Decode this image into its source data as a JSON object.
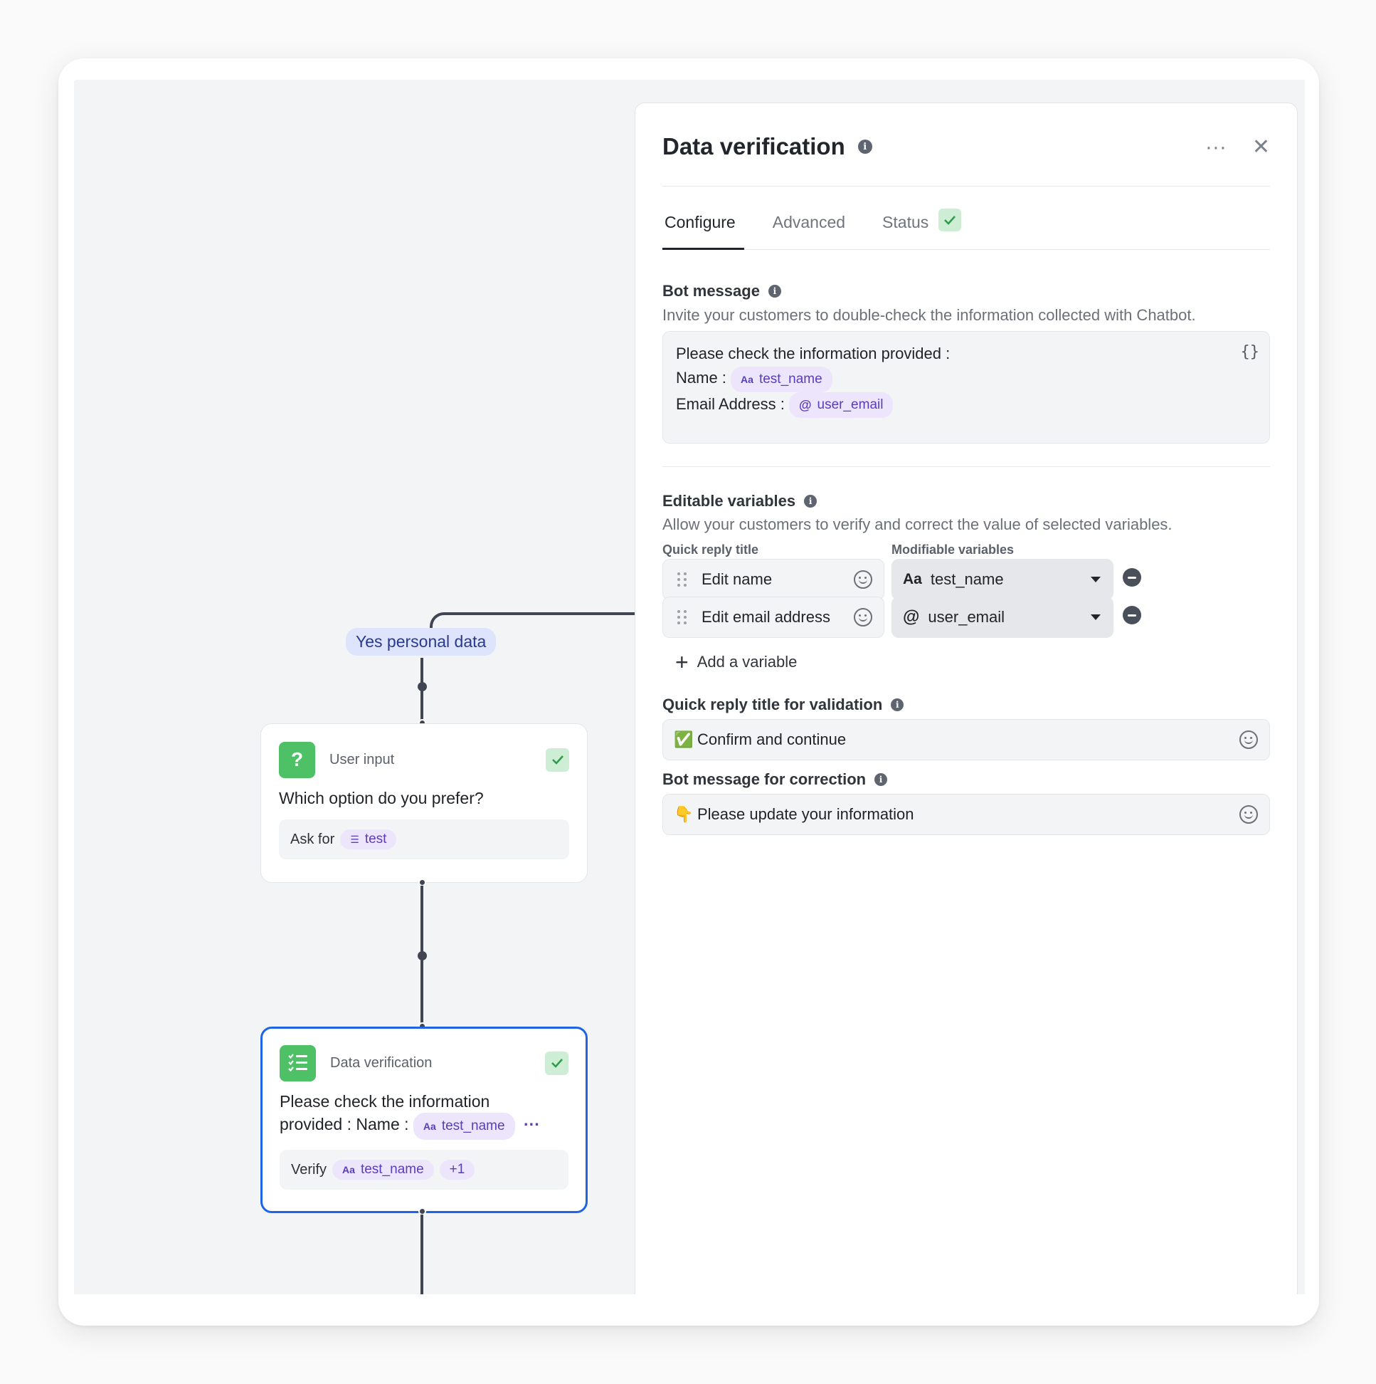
{
  "canvas": {
    "branch_tag": "Yes personal data",
    "user_input_node": {
      "type": "User input",
      "icon": "question-icon",
      "icon_glyph": "?",
      "question": "Which option do you prefer?",
      "footer_label": "Ask for",
      "variable": "test"
    },
    "data_verification_node": {
      "type": "Data verification",
      "icon": "checklist-icon",
      "text_line1": "Please check the information",
      "text_line2": "provided : Name :",
      "variable": "test_name",
      "ellipsis": "···",
      "footer_label": "Verify",
      "footer_variable": "test_name",
      "extra_count": "+1"
    }
  },
  "panel": {
    "title": "Data verification",
    "more_icon": "···",
    "close_icon": "✕",
    "tabs": [
      {
        "label": "Configure",
        "active": true
      },
      {
        "label": "Advanced",
        "active": false
      },
      {
        "label": "Status",
        "active": false
      }
    ],
    "bot_message": {
      "label": "Bot message",
      "description": "Invite your customers to double-check the information collected with Chatbot.",
      "line1": "Please check the information provided :",
      "line2_label": "Name :",
      "line2_var_prefix": "Aa",
      "line2_var": "test_name",
      "line3_label": "Email Address :",
      "line3_var_prefix": "@",
      "line3_var": "user_email",
      "variables_button": "{}"
    },
    "editable_variables": {
      "label": "Editable variables",
      "description": "Allow your customers to verify and correct the value of selected variables.",
      "col_quick_reply": "Quick reply title",
      "col_modifiable": "Modifiable variables",
      "rows": [
        {
          "title": "Edit name",
          "var_prefix": "Aa",
          "variable": "test_name"
        },
        {
          "title": "Edit email address",
          "var_prefix": "@",
          "variable": "user_email"
        }
      ],
      "add_label": "Add a variable"
    },
    "validation": {
      "label": "Quick reply title for validation",
      "emoji": "✅",
      "value": "Confirm and continue"
    },
    "correction": {
      "label": "Bot message for correction",
      "emoji": "👇",
      "value": "Please update your information"
    }
  },
  "colors": {
    "accent_green": "#4ec167",
    "selected_blue": "#1f63e6",
    "chip_purple": "#5b3db8"
  }
}
